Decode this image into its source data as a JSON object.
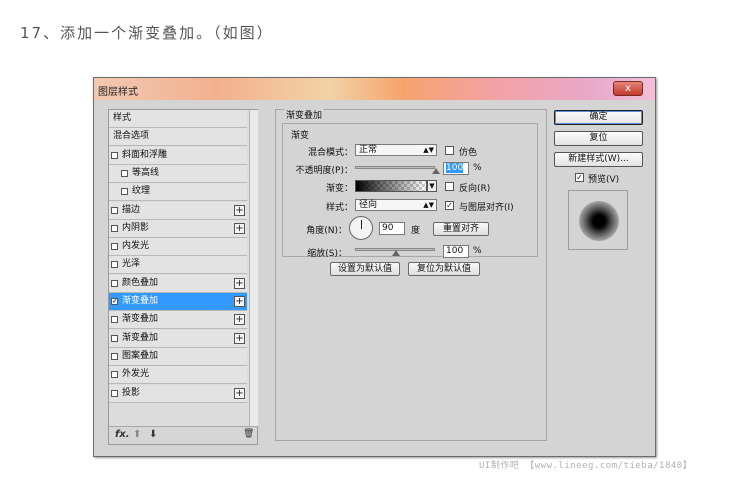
{
  "step_title": "17、添加一个渐变叠加。（如图）",
  "dialog": {
    "title": "图层样式",
    "close": "x"
  },
  "styles_list": {
    "items": [
      {
        "label": "样式",
        "checkbox": false,
        "checked": false,
        "plus": false,
        "selected": false
      },
      {
        "label": "混合选项",
        "checkbox": false,
        "checked": false,
        "plus": false,
        "selected": false
      },
      {
        "label": "斜面和浮雕",
        "checkbox": true,
        "checked": false,
        "plus": false,
        "selected": false
      },
      {
        "label": "等高线",
        "checkbox": true,
        "checked": false,
        "plus": false,
        "selected": false,
        "indent": true
      },
      {
        "label": "纹理",
        "checkbox": true,
        "checked": false,
        "plus": false,
        "selected": false,
        "indent": true
      },
      {
        "label": "描边",
        "checkbox": true,
        "checked": false,
        "plus": true,
        "selected": false
      },
      {
        "label": "内阴影",
        "checkbox": true,
        "checked": false,
        "plus": true,
        "selected": false
      },
      {
        "label": "内发光",
        "checkbox": true,
        "checked": false,
        "plus": false,
        "selected": false
      },
      {
        "label": "光泽",
        "checkbox": true,
        "checked": false,
        "plus": false,
        "selected": false
      },
      {
        "label": "颜色叠加",
        "checkbox": true,
        "checked": false,
        "plus": true,
        "selected": false
      },
      {
        "label": "渐变叠加",
        "checkbox": true,
        "checked": true,
        "plus": true,
        "selected": true
      },
      {
        "label": "渐变叠加",
        "checkbox": true,
        "checked": false,
        "plus": true,
        "selected": false
      },
      {
        "label": "渐变叠加",
        "checkbox": true,
        "checked": false,
        "plus": true,
        "selected": false
      },
      {
        "label": "图案叠加",
        "checkbox": true,
        "checked": false,
        "plus": false,
        "selected": false
      },
      {
        "label": "外发光",
        "checkbox": true,
        "checked": false,
        "plus": false,
        "selected": false
      },
      {
        "label": "投影",
        "checkbox": true,
        "checked": false,
        "plus": true,
        "selected": false
      }
    ],
    "footer": {
      "fx": "fx.",
      "up": "⬆",
      "down": "⬇",
      "trash": "🗑"
    }
  },
  "panel": {
    "group_title": "渐变叠加",
    "sub_title": "渐变",
    "blend_mode_label": "混合模式：",
    "blend_mode_value": "正常",
    "dither_label": "仿色",
    "opacity_label": "不透明度(P)：",
    "opacity_value": "100",
    "opacity_unit": "%",
    "gradient_label": "渐变：",
    "reverse_label": "反向(R)",
    "style_label": "样式：",
    "style_value": "径向",
    "align_label": "与图层对齐(I)",
    "angle_label": "角度(N)：",
    "angle_value": "90",
    "angle_unit": "度",
    "reset_align_label": "重置对齐",
    "scale_label": "缩放(S)：",
    "scale_value": "100",
    "scale_unit": "%",
    "set_default_label": "设置为默认值",
    "reset_default_label": "复位为默认值",
    "opacity_level": 1.0,
    "scale_level": 0.5,
    "dither_checked": false,
    "reverse_checked": false,
    "align_checked": true
  },
  "right": {
    "ok_label": "确定",
    "reset_label": "复位",
    "new_style_label": "新建样式(W)...",
    "preview_label": "预览(V)",
    "preview_checked": true
  },
  "watermark": "UI制作吧 【www.lineeg.com/tieba/1840】"
}
